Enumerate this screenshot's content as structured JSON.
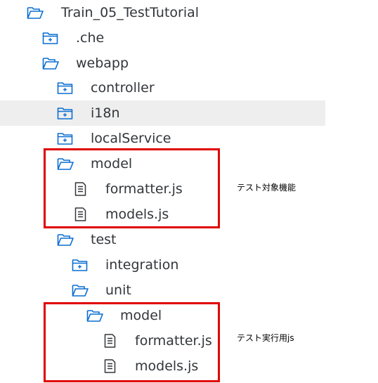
{
  "colors": {
    "icon_stroke": "#0a6ed1",
    "text": "#32363a",
    "selected_row_bg": "#eeeeee",
    "annotation_box": "#e00000"
  },
  "tree": [
    {
      "label": "Train_05_TestTutorial",
      "icon": "folder-open-icon"
    },
    {
      "label": ".che",
      "icon": "folder-closed-icon"
    },
    {
      "label": "webapp",
      "icon": "folder-open-icon"
    },
    {
      "label": "controller",
      "icon": "folder-closed-icon"
    },
    {
      "label": "i18n",
      "icon": "folder-closed-icon",
      "selected": true
    },
    {
      "label": "localService",
      "icon": "folder-closed-icon"
    },
    {
      "label": "model",
      "icon": "folder-open-icon"
    },
    {
      "label": "formatter.js",
      "icon": "file-icon"
    },
    {
      "label": "models.js",
      "icon": "file-icon"
    },
    {
      "label": "test",
      "icon": "folder-open-icon"
    },
    {
      "label": "integration",
      "icon": "folder-closed-icon"
    },
    {
      "label": "unit",
      "icon": "folder-open-icon"
    },
    {
      "label": "model",
      "icon": "folder-open-icon"
    },
    {
      "label": "formatter.js",
      "icon": "file-icon"
    },
    {
      "label": "models.js",
      "icon": "file-icon"
    }
  ],
  "annotations": [
    {
      "text": "テスト対象機能"
    },
    {
      "text": "テスト実行用js"
    }
  ]
}
